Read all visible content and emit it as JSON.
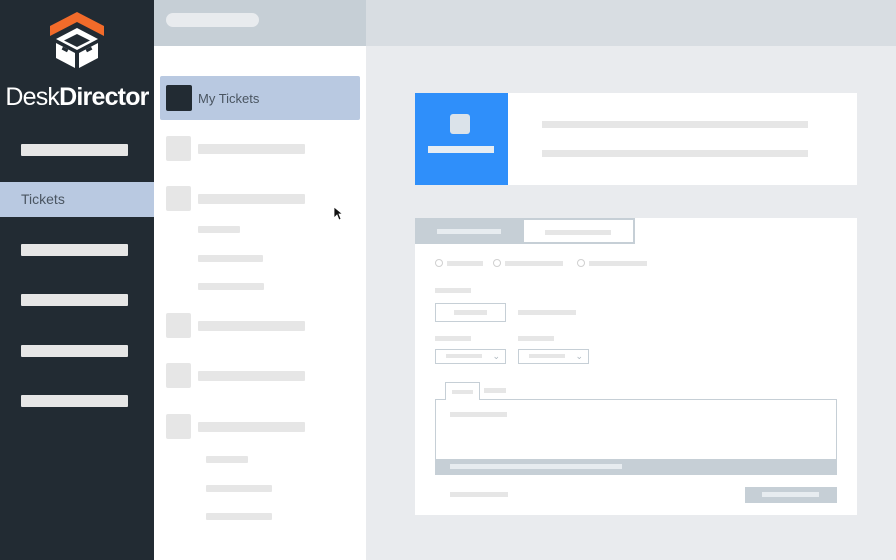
{
  "brand": {
    "name_light": "Desk",
    "name_bold": "Director",
    "logo_icon": "deskdirector-cube-logo",
    "accent_orange": "#f26b2a"
  },
  "sidebar": {
    "active_item": "Tickets",
    "background": "#222b33",
    "active_background": "#b9c9e1"
  },
  "middle_panel": {
    "selected_item": "My Tickets"
  },
  "main": {
    "highlight_card_color": "#2f8ffa",
    "cursor_icon": "mouse-pointer-icon"
  }
}
